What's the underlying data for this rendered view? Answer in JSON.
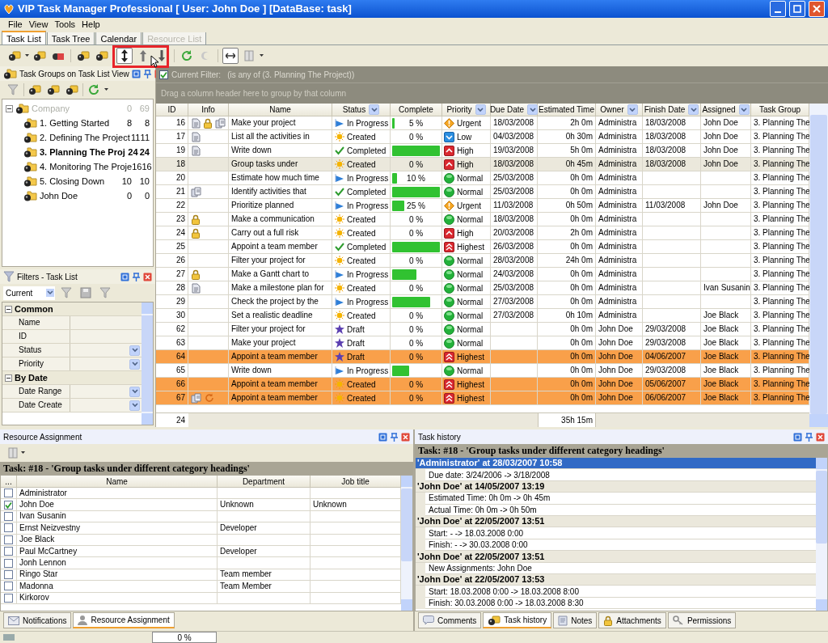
{
  "window": {
    "title": "VIP Task Manager Professional [ User: John Doe ] [DataBase: task]"
  },
  "menu": [
    "File",
    "View",
    "Tools",
    "Help"
  ],
  "tabs": [
    {
      "label": "Task List",
      "selected": true,
      "disabled": false
    },
    {
      "label": "Task Tree",
      "selected": false,
      "disabled": false
    },
    {
      "label": "Calendar",
      "selected": false,
      "disabled": false
    },
    {
      "label": "Resource List",
      "selected": false,
      "disabled": true
    }
  ],
  "groups_panel": {
    "title": "Task Groups on Task List View",
    "tree": [
      {
        "label": "Company",
        "count_1": "0",
        "count_2": "69",
        "disabled": true,
        "expanded": true,
        "selected": false,
        "children": [
          {
            "label": "1. Getting Started",
            "count_1": "8",
            "count_2": "8",
            "disabled": false,
            "selected": false
          },
          {
            "label": "2. Defining The Project",
            "count_1": "11",
            "count_2": "11",
            "disabled": false,
            "selected": false
          },
          {
            "label": "3. Planning The Proj",
            "count_1": "24",
            "count_2": "24",
            "disabled": false,
            "selected": true
          },
          {
            "label": "4. Monitoring The Proje",
            "count_1": "16",
            "count_2": "16",
            "disabled": false,
            "selected": false
          },
          {
            "label": "5. Closing Down",
            "count_1": "10",
            "count_2": "10",
            "disabled": false,
            "selected": false
          },
          {
            "label": "John Doe",
            "count_1": "0",
            "count_2": "0",
            "disabled": false,
            "selected": false
          }
        ]
      }
    ]
  },
  "filters_panel": {
    "title": "Filters - Task List",
    "preset": "Current",
    "categories": [
      {
        "label": "Common",
        "expanded": true,
        "fields": [
          {
            "label": "Name",
            "dropdown": false
          },
          {
            "label": "ID",
            "dropdown": false
          },
          {
            "label": "Status",
            "dropdown": true
          },
          {
            "label": "Priority",
            "dropdown": true
          }
        ]
      },
      {
        "label": "By Date",
        "expanded": true,
        "fields": [
          {
            "label": "Date Range",
            "dropdown": true
          },
          {
            "label": "Date Create",
            "dropdown": true
          }
        ]
      }
    ]
  },
  "task_list": {
    "filter": {
      "checked": true,
      "label": "Current Filter:",
      "text": "(is any of (3. Planning The Project))"
    },
    "group_hint": "Drag a column header here to group by that column",
    "columns": [
      {
        "label": "ID",
        "filter": false
      },
      {
        "label": "Info",
        "filter": false
      },
      {
        "label": "Name",
        "filter": false
      },
      {
        "label": "Status",
        "filter": true
      },
      {
        "label": "Complete",
        "filter": false
      },
      {
        "label": "Priority",
        "filter": true
      },
      {
        "label": "Due Date",
        "filter": true
      },
      {
        "label": "Estimated Time",
        "filter": false
      },
      {
        "label": "Owner",
        "filter": true
      },
      {
        "label": "Finish Date",
        "filter": true
      },
      {
        "label": "Assigned",
        "filter": true
      },
      {
        "label": "Task Group",
        "filter": false
      }
    ],
    "rows": [
      {
        "id": "16",
        "info": [
          {
            "kind": "note"
          },
          {
            "kind": "lock"
          },
          {
            "kind": "stack"
          }
        ],
        "name": "Make your project",
        "status": {
          "kind": "in_progress",
          "label": "In Progress"
        },
        "level": 0.05,
        "complete": "5 %",
        "priority": {
          "kind": "urgent",
          "label": "Urgent"
        },
        "due": "18/03/2008",
        "estimated": "2h 0m",
        "owner": "Administra",
        "finish": "18/03/2008",
        "assigned": "John Doe",
        "group": "3. Planning The",
        "selected": false,
        "overdue": false
      },
      {
        "id": "17",
        "info": [
          {
            "kind": "note"
          }
        ],
        "name": "List all the activities in",
        "status": {
          "kind": "created",
          "label": "Created"
        },
        "level": 0,
        "complete": "0 %",
        "priority": {
          "kind": "low",
          "label": "Low"
        },
        "due": "04/03/2008",
        "estimated": "0h 30m",
        "owner": "Administra",
        "finish": "18/03/2008",
        "assigned": "John Doe",
        "group": "3. Planning The",
        "selected": false,
        "overdue": false
      },
      {
        "id": "19",
        "info": [
          {
            "kind": "note"
          }
        ],
        "name": "Write down",
        "status": {
          "kind": "completed",
          "label": "Completed"
        },
        "level": 1,
        "priority": {
          "kind": "high",
          "label": "High"
        },
        "due": "19/03/2008",
        "estimated": "5h 0m",
        "owner": "Administra",
        "finish": "18/03/2008",
        "assigned": "John Doe",
        "group": "3. Planning The",
        "selected": false,
        "overdue": false
      },
      {
        "id": "18",
        "name": "Group tasks under",
        "status": {
          "kind": "created",
          "label": "Created"
        },
        "level": 0,
        "complete": "0 %",
        "priority": {
          "kind": "high",
          "label": "High"
        },
        "due": "18/03/2008",
        "estimated": "0h 45m",
        "owner": "Administra",
        "finish": "18/03/2008",
        "assigned": "John Doe",
        "group": "3. Planning The",
        "selected": true,
        "overdue": false
      },
      {
        "id": "20",
        "name": "Estimate how much time",
        "status": {
          "kind": "in_progress",
          "label": "In Progress"
        },
        "level": 0.1,
        "complete": "10 %",
        "priority": {
          "kind": "normal",
          "label": "Normal"
        },
        "due": "25/03/2008",
        "estimated": "0h 0m",
        "owner": "Administra",
        "group": "3. Planning The",
        "selected": false,
        "overdue": false
      },
      {
        "id": "21",
        "info": [
          {
            "kind": "stack"
          }
        ],
        "name": "Identify activities that",
        "status": {
          "kind": "completed",
          "label": "Completed"
        },
        "level": 1,
        "priority": {
          "kind": "normal",
          "label": "Normal"
        },
        "due": "25/03/2008",
        "estimated": "0h 0m",
        "owner": "Administra",
        "group": "3. Planning The",
        "selected": false,
        "overdue": false
      },
      {
        "id": "22",
        "name": "Prioritize planned",
        "status": {
          "kind": "in_progress",
          "label": "In Progress"
        },
        "level": 0.25,
        "complete": "25 %",
        "priority": {
          "kind": "urgent",
          "label": "Urgent"
        },
        "due": "11/03/2008",
        "estimated": "0h 50m",
        "owner": "Administra",
        "finish": "11/03/2008",
        "assigned": "John Doe",
        "group": "3. Planning The",
        "selected": false,
        "overdue": false
      },
      {
        "id": "23",
        "info": [
          {
            "kind": "lock"
          }
        ],
        "name": "Make a communication",
        "status": {
          "kind": "created",
          "label": "Created"
        },
        "level": 0,
        "complete": "0 %",
        "priority": {
          "kind": "normal",
          "label": "Normal"
        },
        "due": "18/03/2008",
        "estimated": "0h 0m",
        "owner": "Administra",
        "group": "3. Planning The",
        "selected": false,
        "overdue": false
      },
      {
        "id": "24",
        "info": [
          {
            "kind": "lock"
          }
        ],
        "name": "Carry out a full risk",
        "status": {
          "kind": "created",
          "label": "Created"
        },
        "level": 0,
        "complete": "0 %",
        "priority": {
          "kind": "high",
          "label": "High"
        },
        "due": "20/03/2008",
        "estimated": "2h 0m",
        "owner": "Administra",
        "group": "3. Planning The",
        "selected": false,
        "overdue": false
      },
      {
        "id": "25",
        "name": "Appoint a team member",
        "status": {
          "kind": "completed",
          "label": "Completed"
        },
        "level": 1,
        "priority": {
          "kind": "highest",
          "label": "Highest"
        },
        "due": "26/03/2008",
        "estimated": "0h 0m",
        "owner": "Administra",
        "group": "3. Planning The",
        "selected": false,
        "overdue": false
      },
      {
        "id": "26",
        "name": "Filter your project for",
        "status": {
          "kind": "created",
          "label": "Created"
        },
        "level": 0,
        "complete": "0 %",
        "priority": {
          "kind": "normal",
          "label": "Normal"
        },
        "due": "28/03/2008",
        "estimated": "24h 0m",
        "owner": "Administra",
        "group": "3. Planning The",
        "selected": false,
        "overdue": false
      },
      {
        "id": "27",
        "info": [
          {
            "kind": "lock"
          }
        ],
        "name": "Make a Gantt chart to",
        "status": {
          "kind": "in_progress",
          "label": "In Progress"
        },
        "level": 0.5,
        "priority": {
          "kind": "normal",
          "label": "Normal"
        },
        "due": "24/03/2008",
        "estimated": "0h 0m",
        "owner": "Administra",
        "group": "3. Planning The",
        "selected": false,
        "overdue": false
      },
      {
        "id": "28",
        "info": [
          {
            "kind": "note"
          }
        ],
        "name": "Make a milestone plan for",
        "status": {
          "kind": "created",
          "label": "Created"
        },
        "level": 0,
        "complete": "0 %",
        "priority": {
          "kind": "normal",
          "label": "Normal"
        },
        "due": "25/03/2008",
        "estimated": "0h 0m",
        "owner": "Administra",
        "assigned": "Ivan Susanin",
        "group": "3. Planning The",
        "selected": false,
        "overdue": false
      },
      {
        "id": "29",
        "name": "Check the project by the",
        "status": {
          "kind": "in_progress",
          "label": "In Progress"
        },
        "level": 0.8,
        "priority": {
          "kind": "normal",
          "label": "Normal"
        },
        "due": "27/03/2008",
        "estimated": "0h 0m",
        "owner": "Administra",
        "group": "3. Planning The",
        "selected": false,
        "overdue": false
      },
      {
        "id": "30",
        "name": "Set a realistic deadline",
        "status": {
          "kind": "created",
          "label": "Created"
        },
        "level": 0,
        "complete": "0 %",
        "priority": {
          "kind": "normal",
          "label": "Normal"
        },
        "due": "27/03/2008",
        "estimated": "0h 10m",
        "owner": "Administra",
        "assigned": "Joe Black",
        "group": "3. Planning The",
        "selected": false,
        "overdue": false
      },
      {
        "id": "62",
        "name": "Filter your project for",
        "status": {
          "kind": "draft",
          "label": "Draft"
        },
        "level": 0,
        "complete": "0 %",
        "priority": {
          "kind": "normal",
          "label": "Normal"
        },
        "estimated": "0h 0m",
        "owner": "John Doe",
        "finish": "29/03/2008",
        "assigned": "Joe Black",
        "group": "3. Planning The",
        "selected": false,
        "overdue": false
      },
      {
        "id": "63",
        "name": "Make your project",
        "status": {
          "kind": "draft",
          "label": "Draft"
        },
        "level": 0,
        "complete": "0 %",
        "priority": {
          "kind": "normal",
          "label": "Normal"
        },
        "estimated": "0h 0m",
        "owner": "John Doe",
        "finish": "29/03/2008",
        "assigned": "Joe Black",
        "group": "3. Planning The",
        "selected": false,
        "overdue": false
      },
      {
        "id": "64",
        "name": "Appoint a team member",
        "status": {
          "kind": "draft",
          "label": "Draft"
        },
        "level": 0,
        "complete": "0 %",
        "priority": {
          "kind": "highest",
          "label": "Highest"
        },
        "estimated": "0h 0m",
        "owner": "John Doe",
        "finish": "04/06/2007",
        "assigned": "Joe Black",
        "group": "3. Planning The",
        "selected": false,
        "overdue": true
      },
      {
        "id": "65",
        "name": "Write down",
        "status": {
          "kind": "in_progress",
          "label": "In Progress"
        },
        "level": 0.35,
        "priority": {
          "kind": "normal",
          "label": "Normal"
        },
        "estimated": "0h 0m",
        "owner": "John Doe",
        "finish": "29/03/2008",
        "assigned": "Joe Black",
        "group": "3. Planning The",
        "selected": false,
        "overdue": false
      },
      {
        "id": "66",
        "name": "Appoint a team member",
        "status": {
          "kind": "created",
          "label": "Created"
        },
        "level": 0,
        "complete": "0 %",
        "priority": {
          "kind": "highest",
          "label": "Highest"
        },
        "estimated": "0h 0m",
        "owner": "John Doe",
        "finish": "05/06/2007",
        "assigned": "Joe Black",
        "group": "3. Planning The",
        "selected": false,
        "overdue": true
      },
      {
        "id": "67",
        "info": [
          {
            "kind": "stack"
          },
          {
            "kind": "refresh"
          }
        ],
        "name": "Appoint a team member",
        "status": {
          "kind": "created",
          "label": "Created"
        },
        "level": 0,
        "complete": "0 %",
        "priority": {
          "kind": "highest",
          "label": "Highest"
        },
        "estimated": "0h 0m",
        "owner": "John Doe",
        "finish": "06/06/2007",
        "assigned": "Joe Black",
        "group": "3. Planning The",
        "selected": false,
        "overdue": true
      }
    ],
    "footer": {
      "count": "24",
      "estimated_total": "35h 15m"
    }
  },
  "resource_panel": {
    "title": "Resource Assignment",
    "task_caption": "Task: #18 - 'Group tasks under different category headings'",
    "columns": [
      "...",
      "Name",
      "Department",
      "Job title"
    ],
    "rows": [
      {
        "name": "Administrator",
        "checked": false
      },
      {
        "name": "John Doe",
        "checked": true,
        "department": "Unknown",
        "job_title": "Unknown"
      },
      {
        "name": "Ivan Susanin",
        "checked": false
      },
      {
        "name": "Ernst Neizvestny",
        "checked": false,
        "department": "Developer"
      },
      {
        "name": "Joe Black",
        "checked": false
      },
      {
        "name": "Paul McCartney",
        "checked": false,
        "department": "Developer"
      },
      {
        "name": "Jonh Lennon",
        "checked": false
      },
      {
        "name": "Ringo Star",
        "checked": false,
        "department": "Team member"
      },
      {
        "name": "Madonna",
        "checked": false,
        "department": "Team Member"
      },
      {
        "name": "Kirkorov",
        "checked": false
      }
    ],
    "tabs": [
      {
        "label": "Notifications",
        "selected": false
      },
      {
        "label": "Resource Assignment",
        "selected": true
      }
    ]
  },
  "history_panel": {
    "title": "Task history",
    "task_caption": "Task: #18 - 'Group tasks under different category headings'",
    "entries": [
      {
        "header": "'Administrator' at 28/03/2007 10:58",
        "selected": true,
        "changes": [
          "Due date: 3/24/2006 -> 3/18/2008"
        ]
      },
      {
        "header": "'John Doe' at 14/05/2007 13:19",
        "selected": false,
        "changes": [
          "Estimated Time: 0h 0m -> 0h 45m",
          "Actual Time: 0h 0m -> 0h 50m"
        ]
      },
      {
        "header": "'John Doe' at 22/05/2007 13:51",
        "selected": false,
        "changes": [
          "Start: - -> 18.03.2008 0:00",
          "Finish: - -> 30.03.2008 0:00"
        ]
      },
      {
        "header": "'John Doe' at 22/05/2007 13:51",
        "selected": false,
        "changes": [
          "New Assignments: John Doe"
        ]
      },
      {
        "header": "'John Doe' at 22/05/2007 13:53",
        "selected": false,
        "changes": [
          "Start: 18.03.2008 0:00 -> 18.03.2008 8:00",
          "Finish: 30.03.2008 0:00 -> 18.03.2008 8:30"
        ]
      }
    ],
    "tabs": [
      {
        "label": "Comments",
        "selected": false
      },
      {
        "label": "Task history",
        "selected": true
      },
      {
        "label": "Notes",
        "selected": false
      },
      {
        "label": "Attachments",
        "selected": false
      },
      {
        "label": "Permissions",
        "selected": false
      }
    ]
  },
  "status_bar": {
    "progress": "0 %",
    "level": 0
  }
}
